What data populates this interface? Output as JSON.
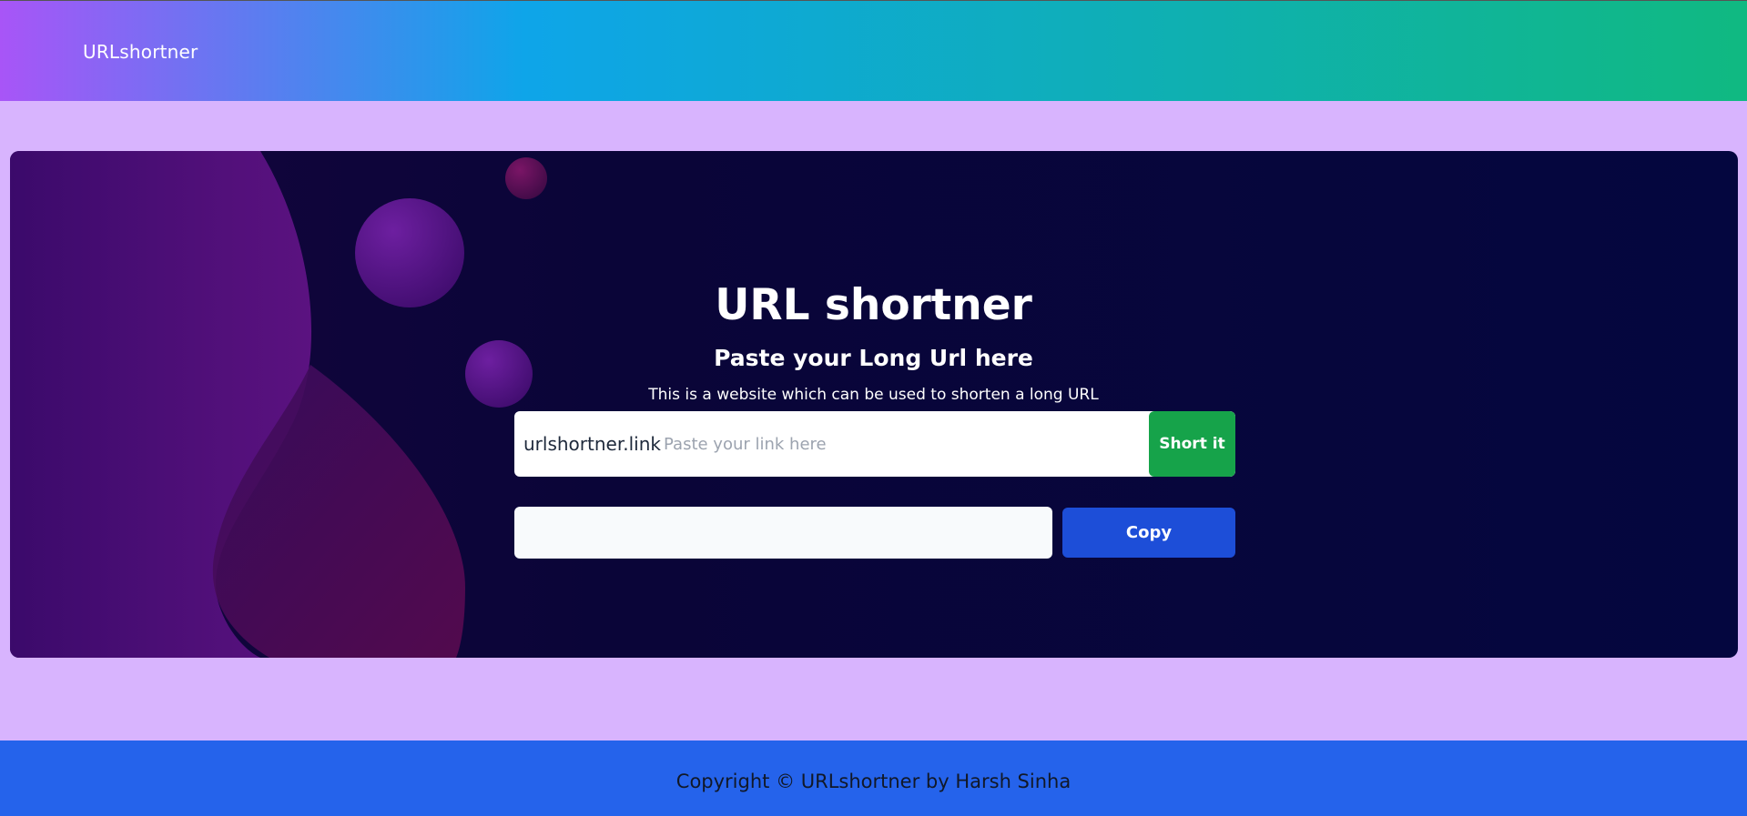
{
  "navbar": {
    "brand": "URLshortner"
  },
  "hero": {
    "title": "URL shortner",
    "subtitle": "Paste your Long Url here",
    "description": "This is a website which can be used to shorten a long URL"
  },
  "shorten_form": {
    "prefix": "urlshortner.link",
    "input_value": "",
    "input_placeholder": "Paste your link here",
    "submit_label": "Short it"
  },
  "result": {
    "value": "",
    "copy_label": "Copy"
  },
  "footer": {
    "text": "Copyright © URLshortner by Harsh Sinha"
  },
  "colors": {
    "page_bg": "#d8b4fe",
    "nav_gradient_start": "#a855f7",
    "nav_gradient_mid": "#0ea5e9",
    "nav_gradient_end": "#10b981",
    "hero_bg": "#04063f",
    "short_button": "#16a34a",
    "copy_button": "#1d4ed8",
    "footer_bg": "#2563eb"
  }
}
